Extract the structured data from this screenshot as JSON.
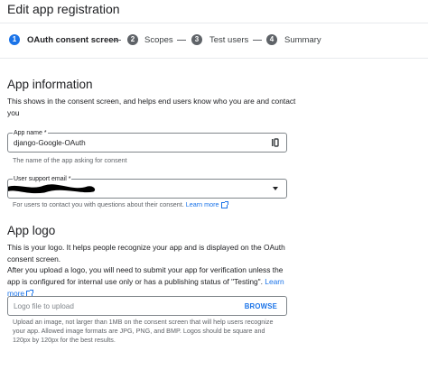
{
  "header": {
    "title": "Edit app registration"
  },
  "stepper": {
    "steps": [
      {
        "number": "1",
        "label": "OAuth consent screen"
      },
      {
        "number": "2",
        "label": "Scopes"
      },
      {
        "number": "3",
        "label": "Test users"
      },
      {
        "number": "4",
        "label": "Summary"
      }
    ],
    "active_color": "#1a73e8",
    "inactive_color": "#5f6368"
  },
  "app_information": {
    "heading": "App information",
    "description": "This shows in the consent screen, and helps end users know who you are and contact you",
    "app_name": {
      "label": "App name *",
      "value": "django-Google-OAuth",
      "helper": "The name of the app asking for consent"
    },
    "support_email": {
      "label": "User support email *",
      "helper": "For users to contact you with questions about their consent.",
      "learn_more": "Learn more"
    }
  },
  "app_logo": {
    "heading": "App logo",
    "description_1": "This is your logo. It helps people recognize your app and is displayed on the OAuth consent screen.",
    "description_2": "After you upload a logo, you will need to submit your app for verification unless the app is configured for internal use only or has a publishing status of \"Testing\".",
    "learn_more": "Learn more",
    "upload": {
      "placeholder": "Logo file to upload",
      "browse_label": "BROWSE",
      "helper": "Upload an image, not larger than 1MB on the consent screen that will help users recognize your app. Allowed image formats are JPG, PNG, and BMP. Logos should be square and 120px by 120px for the best results."
    }
  }
}
